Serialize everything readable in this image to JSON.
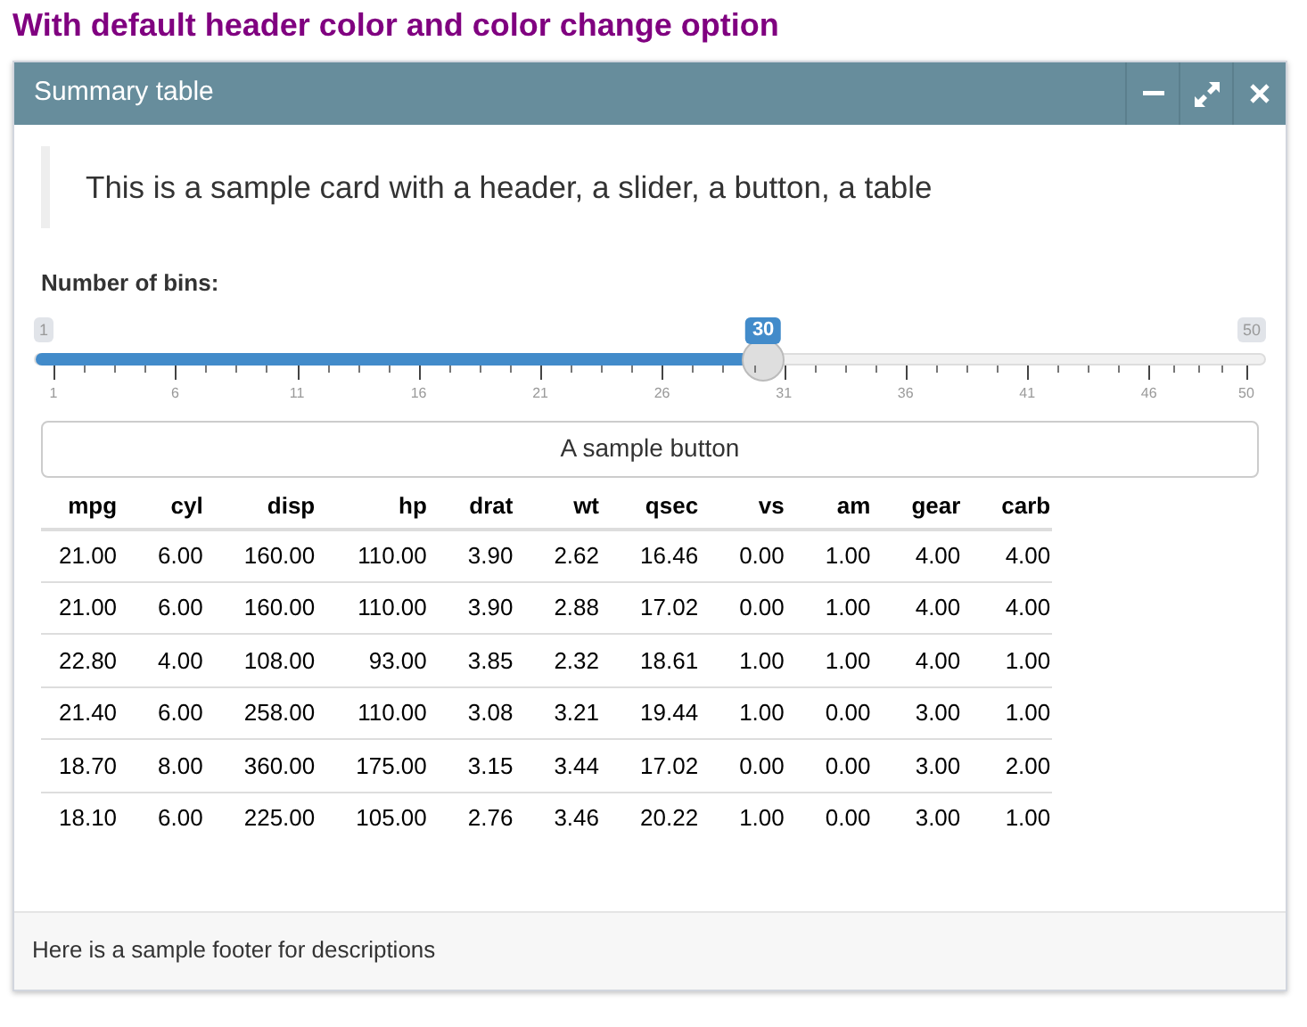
{
  "heading": "With default header color and color change option",
  "card": {
    "title": "Summary table",
    "tools": [
      {
        "kind": "minimize"
      },
      {
        "kind": "maximize"
      },
      {
        "kind": "close"
      }
    ],
    "quote": "This is a sample card with a header, a slider, a button, a table",
    "slider": {
      "label": "Number of bins:",
      "min": "1",
      "max": "50",
      "value": "30",
      "level": 0.592,
      "ticks": [
        "1",
        "6",
        "11",
        "16",
        "21",
        "26",
        "31",
        "36",
        "41",
        "46",
        "50"
      ]
    },
    "button": "A sample button",
    "table": {
      "columns": [
        "mpg",
        "cyl",
        "disp",
        "hp",
        "drat",
        "wt",
        "qsec",
        "vs",
        "am",
        "gear",
        "carb"
      ],
      "rows": [
        [
          "21.00",
          "6.00",
          "160.00",
          "110.00",
          "3.90",
          "2.62",
          "16.46",
          "0.00",
          "1.00",
          "4.00",
          "4.00"
        ],
        [
          "21.00",
          "6.00",
          "160.00",
          "110.00",
          "3.90",
          "2.88",
          "17.02",
          "0.00",
          "1.00",
          "4.00",
          "4.00"
        ],
        [
          "22.80",
          "4.00",
          "108.00",
          "93.00",
          "3.85",
          "2.32",
          "18.61",
          "1.00",
          "1.00",
          "4.00",
          "1.00"
        ],
        [
          "21.40",
          "6.00",
          "258.00",
          "110.00",
          "3.08",
          "3.21",
          "19.44",
          "1.00",
          "0.00",
          "3.00",
          "1.00"
        ],
        [
          "18.70",
          "8.00",
          "360.00",
          "175.00",
          "3.15",
          "3.44",
          "17.02",
          "0.00",
          "0.00",
          "3.00",
          "2.00"
        ],
        [
          "18.10",
          "6.00",
          "225.00",
          "105.00",
          "2.76",
          "3.46",
          "20.22",
          "1.00",
          "0.00",
          "3.00",
          "1.00"
        ]
      ]
    },
    "footer": "Here is a sample footer for descriptions"
  }
}
